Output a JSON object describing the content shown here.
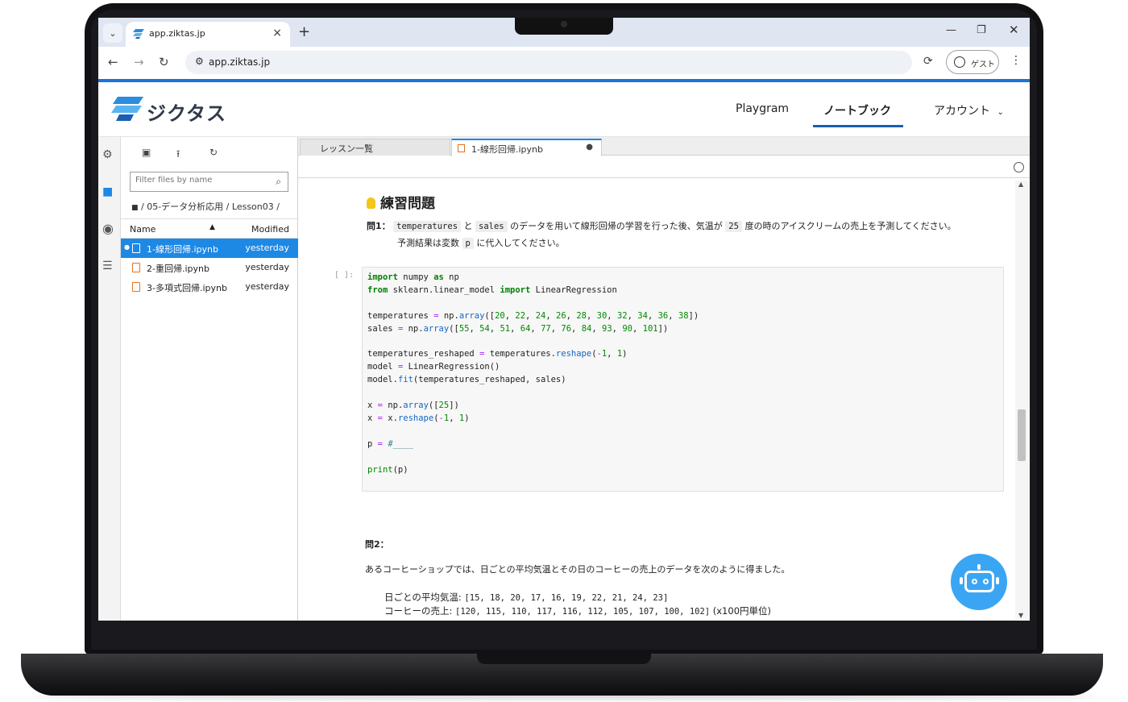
{
  "browser": {
    "tab_title": "app.ziktas.jp",
    "url": "app.ziktas.jp",
    "guest_label": "ゲスト"
  },
  "app": {
    "logo_text": "ジクタス",
    "nav": [
      "Playgram",
      "ノートブック",
      "アカウント"
    ],
    "active_nav": "ノートブック",
    "brand_color": "#1a73d9"
  },
  "filebrowser": {
    "filter_placeholder": "Filter files by name",
    "breadcrumb": "/ 05-データ分析応用 / Lesson03 /",
    "col_name": "Name",
    "col_modified": "Modified",
    "files": [
      {
        "name": "1-線形回帰.ipynb",
        "modified": "yesterday",
        "selected": true
      },
      {
        "name": "2-重回帰.ipynb",
        "modified": "yesterday",
        "selected": false
      },
      {
        "name": "3-多項式回帰.ipynb",
        "modified": "yesterday",
        "selected": false
      }
    ]
  },
  "notebook": {
    "tabs": [
      "レッスン一覧",
      "1-線形回帰.ipynb"
    ],
    "dirty_marker": "●",
    "heading": "練習問題",
    "q1": {
      "label": "問1：",
      "code1": "temperatures",
      "t1": "と",
      "code2": "sales",
      "t2": "のデータを用いて線形回帰の学習を行った後、気温が",
      "code3": "25",
      "t3": "度の時のアイスクリームの売上を予測してください。",
      "line2_a": "予測結果は変数",
      "line2_code": "p",
      "line2_b": "に代入してください。"
    },
    "cell_prompt": "[ ]:",
    "q2": {
      "label": "問2：",
      "text": "あるコーヒーショップでは、日ごとの平均気温とその日のコーヒーの売上のデータを次のように得ました。",
      "line1_label": "日ごとの平均気温:",
      "line1_values": "[15, 18, 20, 17, 16, 19, 22, 21, 24, 23]",
      "line2_label": "コーヒーの売上:",
      "line2_values": "[120, 115, 110, 117, 116, 112, 105, 107, 100, 102]",
      "line2_unit": "(x100円単位)"
    }
  }
}
